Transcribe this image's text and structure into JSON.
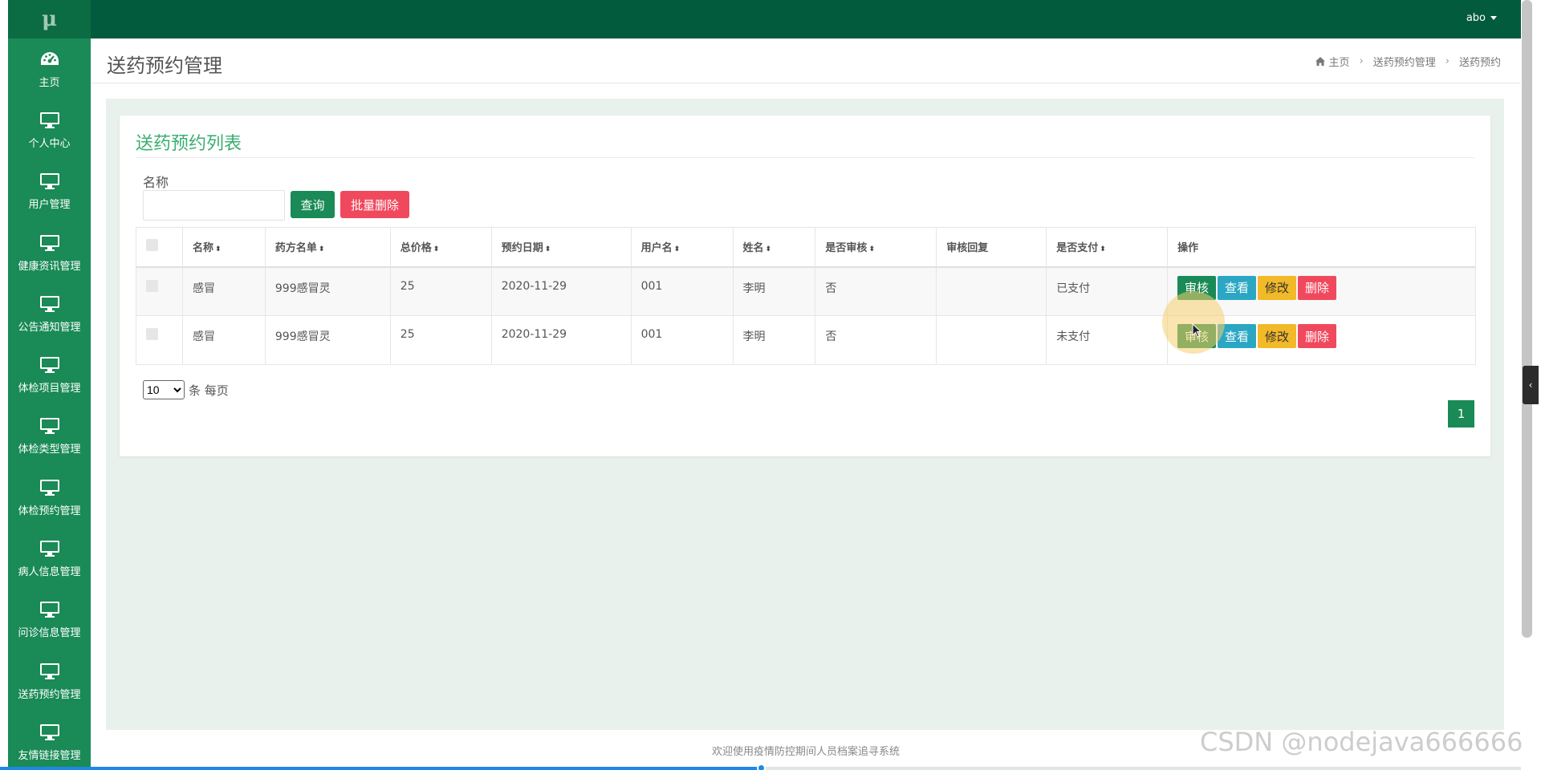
{
  "sidebar": {
    "logo": "μ",
    "items": [
      {
        "label": "主页",
        "icon": "dashboard-icon"
      },
      {
        "label": "个人中心",
        "icon": "monitor-icon"
      },
      {
        "label": "用户管理",
        "icon": "monitor-icon"
      },
      {
        "label": "健康资讯管理",
        "icon": "monitor-icon"
      },
      {
        "label": "公告通知管理",
        "icon": "monitor-icon"
      },
      {
        "label": "体检项目管理",
        "icon": "monitor-icon"
      },
      {
        "label": "体检类型管理",
        "icon": "monitor-icon"
      },
      {
        "label": "体检预约管理",
        "icon": "monitor-icon"
      },
      {
        "label": "病人信息管理",
        "icon": "monitor-icon"
      },
      {
        "label": "问诊信息管理",
        "icon": "monitor-icon"
      },
      {
        "label": "送药预约管理",
        "icon": "monitor-icon"
      },
      {
        "label": "友情链接管理",
        "icon": "monitor-icon"
      }
    ]
  },
  "topbar": {
    "username": "abo"
  },
  "header": {
    "title": "送药预约管理",
    "breadcrumb": [
      "主页",
      "送药预约管理",
      "送药预约"
    ]
  },
  "panel": {
    "title": "送药预约列表",
    "search": {
      "label": "名称",
      "value": "",
      "placeholder": ""
    },
    "query_label": "查询",
    "batch_delete_label": "批量删除"
  },
  "table": {
    "columns": [
      "名称",
      "药方名单",
      "总价格",
      "预约日期",
      "用户名",
      "姓名",
      "是否审核",
      "审核回复",
      "是否支付",
      "操作"
    ],
    "rows": [
      {
        "name": "感冒",
        "prescription": "999感冒灵",
        "price": "25",
        "date": "2020-11-29",
        "username": "001",
        "realname": "李明",
        "audited": "否",
        "reply": "",
        "paid": "已支付"
      },
      {
        "name": "感冒",
        "prescription": "999感冒灵",
        "price": "25",
        "date": "2020-11-29",
        "username": "001",
        "realname": "李明",
        "audited": "否",
        "reply": "",
        "paid": "未支付"
      }
    ],
    "actions": {
      "audit": "审核",
      "view": "查看",
      "edit": "修改",
      "delete": "删除"
    }
  },
  "pagination": {
    "page_size": "10",
    "page_size_options": [
      "10"
    ],
    "page_size_suffix": "条 每页",
    "current_page": "1"
  },
  "footer": {
    "text": "欢迎使用疫情防控期间人员档案追寻系统",
    "progress": 0.5
  },
  "watermark": "CSDN @nodejava666666",
  "colors": {
    "sidebar": "#1a8a56",
    "topbar": "#025b3d",
    "accent": "#3cae73",
    "danger": "#f0495e",
    "info": "#2ba7c4",
    "warning": "#f2b928"
  }
}
